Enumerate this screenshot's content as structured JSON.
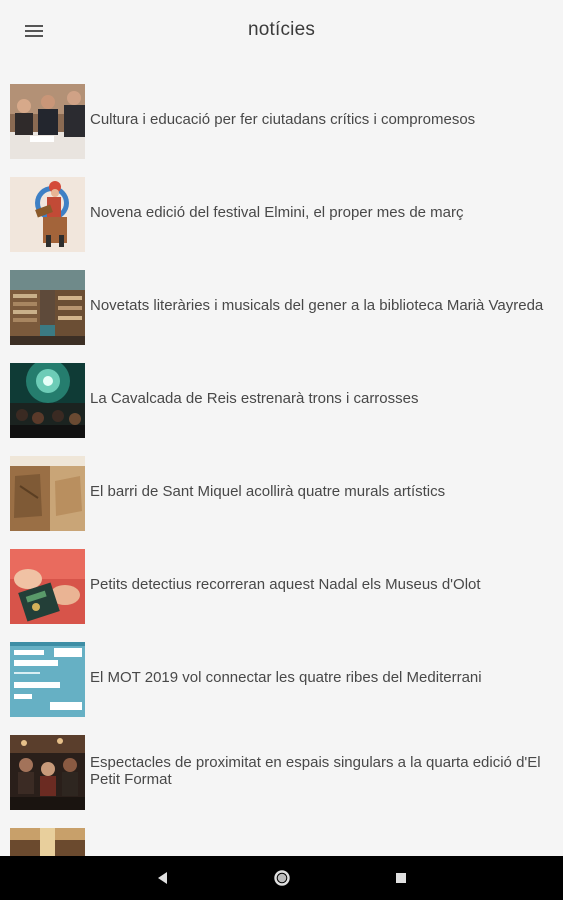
{
  "app_bar": {
    "title": "notícies",
    "menu_icon": "hamburger-menu-icon"
  },
  "news": [
    {
      "headline": "Cultura i educació per fer ciutadans crítics i compromesos",
      "thumb_icon": "people-at-table-photo"
    },
    {
      "headline": "Novena edició del festival Elmini, el proper mes de març",
      "thumb_icon": "festival-poster-illustration"
    },
    {
      "headline": "Novetats literàries i musicals del gener a la biblioteca Marià Vayreda",
      "thumb_icon": "library-interior-photo"
    },
    {
      "headline": "La Cavalcada de Reis estrenarà trons i carrosses",
      "thumb_icon": "stage-lights-photo"
    },
    {
      "headline": "El barri de Sant Miquel acollirà quatre murals artístics",
      "thumb_icon": "mural-wall-photo"
    },
    {
      "headline": "Petits detectius recorreran aquest Nadal els Museus d'Olot",
      "thumb_icon": "hands-with-booklet-photo"
    },
    {
      "headline": "El MOT 2019 vol connectar les quatre ribes del Mediterrani",
      "thumb_icon": "literary-festival-poster"
    },
    {
      "headline": "Espectacles de proximitat en espais singulars a la quarta edició d'El Petit Format",
      "thumb_icon": "audience-performance-photo"
    },
    {
      "headline": "",
      "thumb_icon": "partial-photo"
    }
  ],
  "system_nav": {
    "back_icon": "back-triangle-icon",
    "home_icon": "home-circle-icon",
    "recents_icon": "recents-square-icon"
  },
  "colors": {
    "background": "#f5f5f5",
    "text": "#484848",
    "nav_bar": "#000000"
  }
}
